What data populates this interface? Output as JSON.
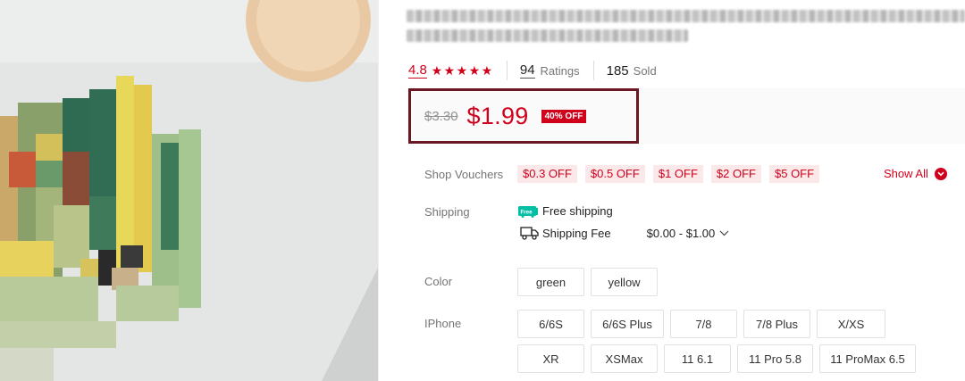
{
  "product": {
    "image_icon": "product-photo"
  },
  "rating": {
    "value": "4.8",
    "stars": [
      "★",
      "★",
      "★",
      "★",
      "★"
    ],
    "ratings_count": "94",
    "ratings_label": "Ratings",
    "sold_count": "185",
    "sold_label": "Sold"
  },
  "price": {
    "original": "$3.30",
    "current": "$1.99",
    "discount": "40% OFF"
  },
  "vouchers": {
    "label": "Shop Vouchers",
    "items": [
      "$0.3 OFF",
      "$0.5 OFF",
      "$1 OFF",
      "$2 OFF",
      "$5 OFF"
    ],
    "show_all": "Show All"
  },
  "shipping": {
    "label": "Shipping",
    "free_badge": "Free",
    "free_text": "Free shipping",
    "fee_label": "Shipping Fee",
    "fee_range": "$0.00 - $1.00"
  },
  "color": {
    "label": "Color",
    "options": [
      "green",
      "yellow"
    ]
  },
  "iphone": {
    "label": "IPhone",
    "options": [
      "6/6S",
      "6/6S Plus",
      "7/8",
      "7/8 Plus",
      "X/XS",
      "XR",
      "XSMax",
      "11 6.1",
      "11 Pro 5.8",
      "11 ProMax 6.5"
    ]
  },
  "colors": {
    "accent": "#d0011b",
    "highlight_border": "#6b1623",
    "free_badge": "#00bfa5"
  }
}
